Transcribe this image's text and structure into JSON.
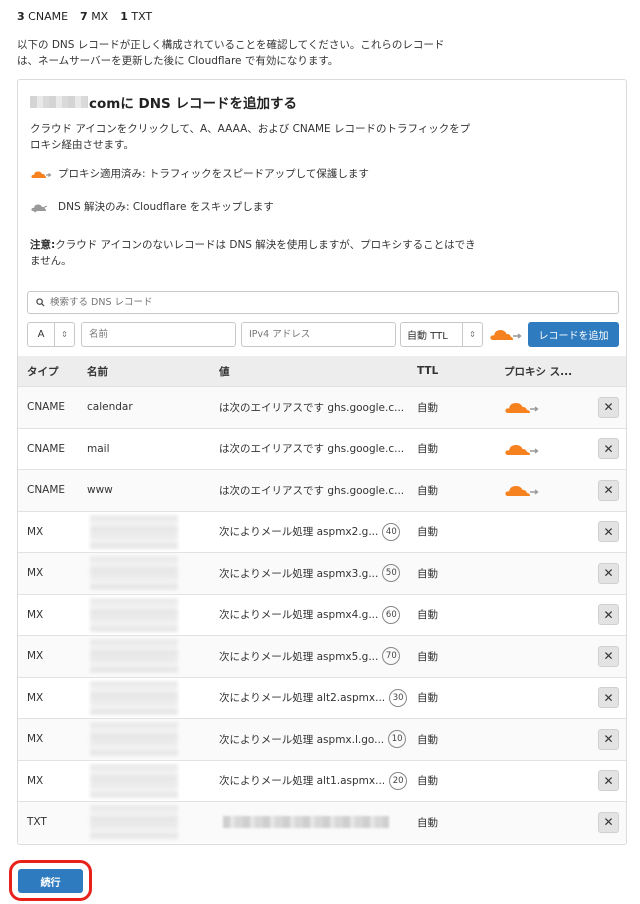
{
  "summary": [
    {
      "count": "3",
      "label": "CNAME"
    },
    {
      "count": "7",
      "label": "MX"
    },
    {
      "count": "1",
      "label": "TXT"
    }
  ],
  "intro": "以下の DNS レコードが正しく構成されていることを確認してください。これらのレコードは、ネームサーバーを更新した後に Cloudflare で有効になります。",
  "card": {
    "title": "comに DNS レコードを追加する",
    "desc": "クラウド アイコンをクリックして、A、AAAA、および CNAME レコードのトラフィックをプロキシ経由させます。",
    "legend_proxied": "プロキシ適用済み: トラフィックをスピードアップして保護します",
    "legend_dns": "DNS 解決のみ: Cloudflare をスキップします",
    "note_bold": "注意:",
    "note": "クラウド アイコンのないレコードは DNS 解決を使用しますが、プロキシすることはできません。"
  },
  "form": {
    "search_placeholder": "検索する DNS レコード",
    "type_value": "A",
    "name_placeholder": "名前",
    "ipv4_placeholder": "IPv4 アドレス",
    "ttl_value": "自動 TTL",
    "add_label": "レコードを追加"
  },
  "table": {
    "headers": [
      "タイプ",
      "名前",
      "値",
      "TTL",
      "プロキシ ス..."
    ],
    "rows": [
      {
        "type": "CNAME",
        "name": "calendar",
        "value": "は次のエイリアスです ghs.google.c...",
        "priority": "",
        "ttl": "自動"
      },
      {
        "type": "CNAME",
        "name": "mail",
        "value": "は次のエイリアスです ghs.google.c...",
        "priority": "",
        "ttl": "自動"
      },
      {
        "type": "CNAME",
        "name": "www",
        "value": "は次のエイリアスです ghs.google.c...",
        "priority": "",
        "ttl": "自動"
      },
      {
        "type": "MX",
        "name": "",
        "value": "次によりメール処理 aspmx2.g...",
        "priority": "40",
        "ttl": "自動"
      },
      {
        "type": "MX",
        "name": "",
        "value": "次によりメール処理 aspmx3.g...",
        "priority": "50",
        "ttl": "自動"
      },
      {
        "type": "MX",
        "name": "",
        "value": "次によりメール処理 aspmx4.g...",
        "priority": "60",
        "ttl": "自動"
      },
      {
        "type": "MX",
        "name": "",
        "value": "次によりメール処理 aspmx5.g...",
        "priority": "70",
        "ttl": "自動"
      },
      {
        "type": "MX",
        "name": "",
        "value": "次によりメール処理 alt2.aspmx...",
        "priority": "30",
        "ttl": "自動"
      },
      {
        "type": "MX",
        "name": "",
        "value": "次によりメール処理 aspmx.l.go...",
        "priority": "10",
        "ttl": "自動"
      },
      {
        "type": "MX",
        "name": "",
        "value": "次によりメール処理 alt1.aspmx...",
        "priority": "20",
        "ttl": "自動"
      },
      {
        "type": "TXT",
        "name": "",
        "value": "",
        "priority": "",
        "ttl": "自動"
      }
    ]
  },
  "continue_label": "続行",
  "colors": {
    "accent": "#2f7bbf",
    "cloud_orange": "#f6821f",
    "highlight": "#e8221b"
  }
}
